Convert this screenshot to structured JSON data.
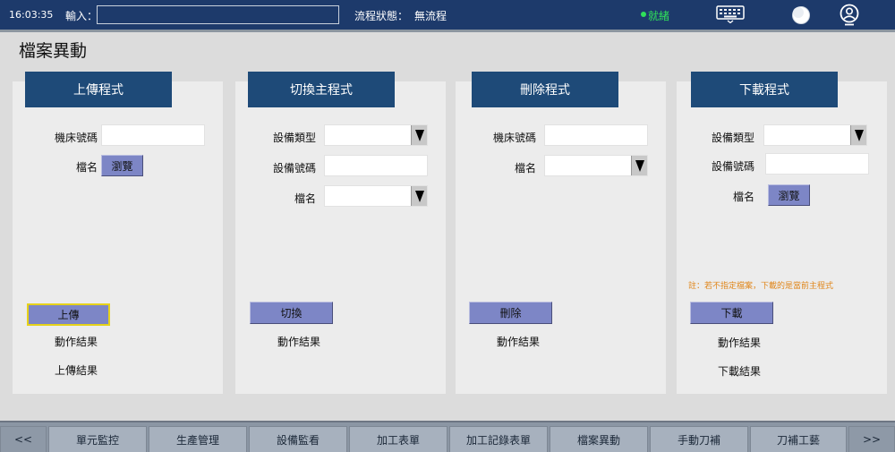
{
  "topbar": {
    "time": "16:03:35",
    "input_label": "輸入：",
    "input_value": "",
    "flow_label": "流程狀態：",
    "flow_value": "無流程",
    "status_text": "就緒",
    "status_color": "#2fe05a"
  },
  "page_title": "檔案異動",
  "panels": [
    {
      "title": "上傳程式",
      "field1_label": "機床號碼",
      "field2_label": "檔名",
      "browse_label": "瀏覽",
      "action_label": "上傳",
      "result1": "動作結果",
      "result2": "上傳結果"
    },
    {
      "title": "切換主程式",
      "field1_label": "設備類型",
      "field2_label": "設備號碼",
      "field3_label": "檔名",
      "action_label": "切換",
      "result1": "動作結果"
    },
    {
      "title": "刪除程式",
      "field1_label": "機床號碼",
      "field2_label": "檔名",
      "action_label": "刪除",
      "result1": "動作結果"
    },
    {
      "title": "下載程式",
      "field1_label": "設備類型",
      "field2_label": "設備號碼",
      "field3_label": "檔名",
      "browse_label": "瀏覽",
      "note": "註：若不指定檔案，下載的是當前主程式",
      "action_label": "下載",
      "result1": "動作結果",
      "result2": "下載結果"
    }
  ],
  "bottom_nav": {
    "prev": "<<",
    "next": ">>",
    "items": [
      "單元監控",
      "生產管理",
      "設備監看",
      "加工表單",
      "加工記錄表單",
      "檔案異動",
      "手動刀補",
      "刀補工藝"
    ]
  },
  "colors": {
    "topbar": "#1d3a6b",
    "panel_header": "#1e4a78",
    "button": "#7d86c6",
    "note": "#e0861a"
  }
}
